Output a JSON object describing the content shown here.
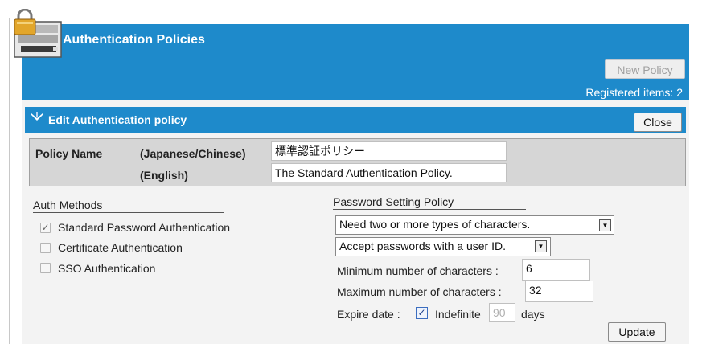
{
  "header": {
    "title": "Authentication Policies",
    "new_policy_label": "New Policy",
    "registered_items": "Registered items: 2"
  },
  "edit": {
    "title": "Edit Authentication policy",
    "close_label": "Close"
  },
  "policy_name": {
    "label": "Policy Name",
    "japanese_label": "(Japanese/Chinese)",
    "english_label": "(English)",
    "japanese_value": "標準認証ポリシー",
    "english_value": "The Standard Authentication Policy."
  },
  "auth_methods": {
    "title": "Auth Methods",
    "items": [
      {
        "label": "Standard Password Authentication",
        "checked": true,
        "enabled": false
      },
      {
        "label": "Certificate Authentication",
        "checked": false,
        "enabled": false
      },
      {
        "label": "SSO Authentication",
        "checked": false,
        "enabled": false
      }
    ]
  },
  "password_policy": {
    "title": "Password Setting Policy",
    "character_types_selected": "Need two or more types of characters.",
    "user_id_selected": "Accept passwords with a user ID.",
    "min_label": "Minimum number of characters :",
    "min_value": "6",
    "max_label": "Maximum number of characters :",
    "max_value": "32",
    "expire_label": "Expire date :",
    "indefinite_label": "Indefinite",
    "indefinite_checked": true,
    "days_value": "90",
    "days_label": "days"
  },
  "update_label": "Update",
  "colors": {
    "header_blue": "#1e8acb",
    "panel_gray": "#f3f3f3"
  },
  "icons": [
    "lock-icon",
    "edit-icon",
    "checkmark-icon",
    "chevron-down-icon"
  ]
}
